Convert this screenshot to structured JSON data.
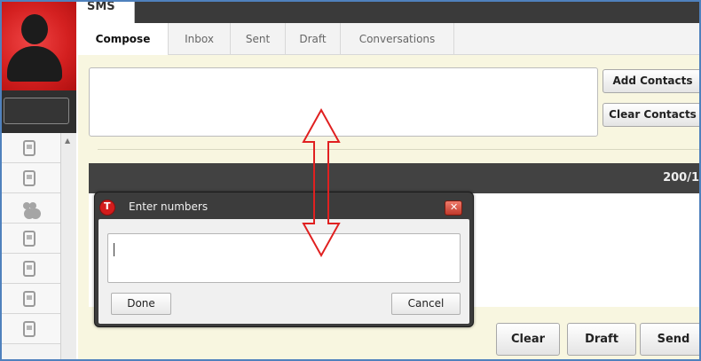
{
  "app": {
    "title": "SMS"
  },
  "tabs": [
    {
      "label": "Compose",
      "active": true
    },
    {
      "label": "Inbox",
      "active": false
    },
    {
      "label": "Sent",
      "active": false
    },
    {
      "label": "Draft",
      "active": false
    },
    {
      "label": "Conversations",
      "active": false
    }
  ],
  "contacts_list": {
    "row_icons": [
      "phone-icon",
      "phone-icon",
      "group-icon",
      "phone-icon",
      "phone-icon",
      "phone-icon",
      "phone-icon"
    ]
  },
  "compose": {
    "add_contacts_label": "Add Contacts",
    "clear_contacts_label": "Clear Contacts",
    "char_counter": "200/1"
  },
  "actions": {
    "clear_label": "Clear",
    "draft_label": "Draft",
    "send_label": "Send"
  },
  "dialog": {
    "title": "Enter numbers",
    "input_value": "",
    "done_label": "Done",
    "cancel_label": "Cancel"
  },
  "colors": {
    "accent_red": "#d42020",
    "dark_bar": "#3a3a3a",
    "compose_bg": "#f8f6e0",
    "annotation_red": "#e02020",
    "frame_blue": "#4f81bd"
  }
}
